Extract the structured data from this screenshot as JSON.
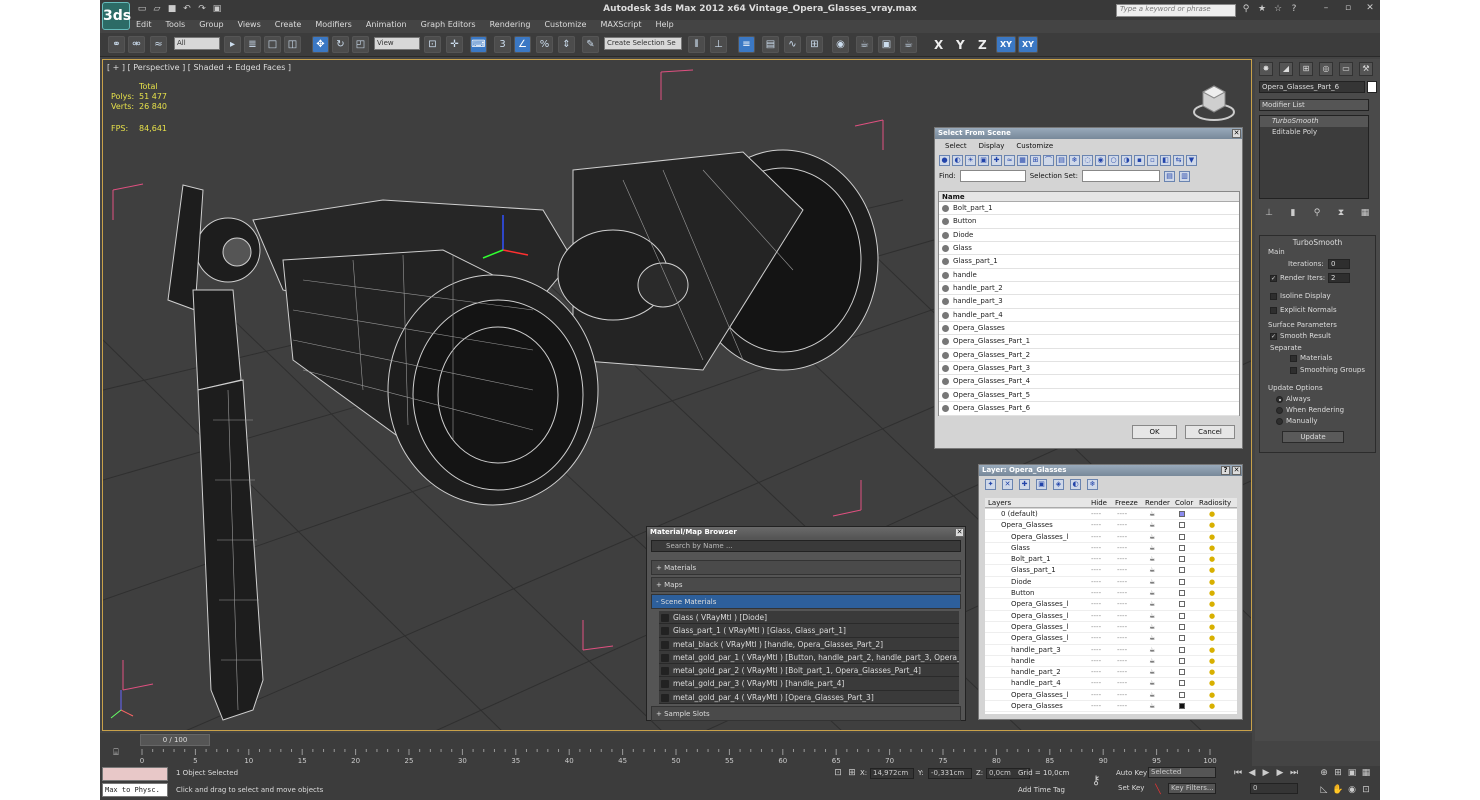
{
  "app": {
    "title": "Autodesk 3ds Max  2012 x64     Vintage_Opera_Glasses_vray.max",
    "logo": "3ds",
    "search_placeholder": "Type a keyword or phrase"
  },
  "menu": [
    "Edit",
    "Tools",
    "Group",
    "Views",
    "Create",
    "Modifiers",
    "Animation",
    "Graph Editors",
    "Rendering",
    "Customize",
    "MAXScript",
    "Help"
  ],
  "toolbar": {
    "filter_value": "All",
    "refcoord_value": "View",
    "selection_set_placeholder": "Create Selection Se",
    "axis_x": "X",
    "axis_y": "Y",
    "axis_z": "Z",
    "axis_xy": "XY",
    "axis_xy2": "XY"
  },
  "viewport": {
    "label": "[ + ] [ Perspective ] [ Shaded + Edged Faces ]",
    "stats_total": "Total",
    "polys_label": "Polys:",
    "polys_value": "51 477",
    "verts_label": "Verts:",
    "verts_value": "26 840",
    "fps_label": "FPS:",
    "fps_value": "84,641"
  },
  "select_from_scene": {
    "title": "Select From Scene",
    "menu": [
      "Select",
      "Display",
      "Customize"
    ],
    "find_label": "Find:",
    "selset_label": "Selection Set:",
    "column_name": "Name",
    "items": [
      "Bolt_part_1",
      "Button",
      "Diode",
      "Glass",
      "Glass_part_1",
      "handle",
      "handle_part_2",
      "handle_part_3",
      "handle_part_4",
      "Opera_Glasses",
      "Opera_Glasses_Part_1",
      "Opera_Glasses_Part_2",
      "Opera_Glasses_Part_3",
      "Opera_Glasses_Part_4",
      "Opera_Glasses_Part_5",
      "Opera_Glasses_Part_6"
    ],
    "ok_label": "OK",
    "cancel_label": "Cancel"
  },
  "layer": {
    "title": "Layer: Opera_Glasses",
    "columns": [
      "Layers",
      "Hide",
      "Freeze",
      "Render",
      "Color",
      "Radiosity"
    ],
    "rows": [
      "0 (default)",
      "Opera_Glasses",
      "Opera_Glasses_l",
      "Glass",
      "Bolt_part_1",
      "Glass_part_1",
      "Diode",
      "Button",
      "Opera_Glasses_l",
      "Opera_Glasses_l",
      "Opera_Glasses_l",
      "Opera_Glasses_l",
      "handle_part_3",
      "handle",
      "handle_part_2",
      "handle_part_4",
      "Opera_Glasses_l",
      "Opera_Glasses"
    ],
    "dash": "----"
  },
  "material_browser": {
    "title": "Material/Map Browser",
    "search_placeholder": "Search by Name ...",
    "sec_materials": "+ Materials",
    "sec_maps": "+ Maps",
    "sec_scene": "- Scene Materials",
    "sec_samples": "+ Sample Slots",
    "items": [
      "Glass  ( VRayMtl )  [Diode]",
      "Glass_part_1  ( VRayMtl )  [Glass, Glass_part_1]",
      "metal_black  ( VRayMtl )  [handle, Opera_Glasses_Part_2]",
      "metal_gold_par_1  ( VRayMtl )  [Button, handle_part_2, handle_part_3, Opera_G...",
      "metal_gold_par_2  ( VRayMtl )  [Bolt_part_1, Opera_Glasses_Part_4]",
      "metal_gold_par_3  ( VRayMtl )  [handle_part_4]",
      "metal_gold_par_4  ( VRayMtl )  [Opera_Glasses_Part_3]"
    ]
  },
  "command_panel": {
    "object_name": "Opera_Glasses_Part_6",
    "modifier_list": "Modifier List",
    "stack": [
      "TurboSmooth",
      "Editable Poly"
    ],
    "rollout_title": "TurboSmooth",
    "main_label": "Main",
    "iterations_label": "Iterations:",
    "iterations_value": "0",
    "render_iters_label": "Render Iters:",
    "render_iters_value": "2",
    "isoline_label": "Isoline Display",
    "explicit_label": "Explicit Normals",
    "surface_params": "Surface Parameters",
    "smooth_result": "Smooth Result",
    "separate": "Separate",
    "materials": "Materials",
    "smoothing_groups": "Smoothing Groups",
    "update_options": "Update Options",
    "always": "Always",
    "when_rendering": "When Rendering",
    "manually": "Manually",
    "update_button": "Update"
  },
  "timeline": {
    "slider": "0 / 100",
    "ticks": [
      "0",
      "5",
      "10",
      "15",
      "20",
      "25",
      "30",
      "35",
      "40",
      "45",
      "50",
      "55",
      "60",
      "65",
      "70",
      "75",
      "80",
      "85",
      "90",
      "95",
      "100"
    ]
  },
  "status": {
    "maxscript": "Max to Physc.",
    "selected": "1 Object Selected",
    "prompt": "Click and drag to select and move objects",
    "x_value": "14,972cm",
    "y_value": "-0,331cm",
    "z_value": "0,0cm",
    "grid": "Grid = 10,0cm",
    "add_time_tag": "Add Time Tag",
    "auto_key": "Auto Key",
    "set_key": "Set Key",
    "selected_dropdown": "Selected",
    "key_filters": "Key Filters...",
    "frame": "0"
  },
  "colors": {
    "accent": "#3b78c4",
    "viewport_border": "#c8a14a",
    "stats": "#e6e04a",
    "bbox": "#e05080"
  }
}
